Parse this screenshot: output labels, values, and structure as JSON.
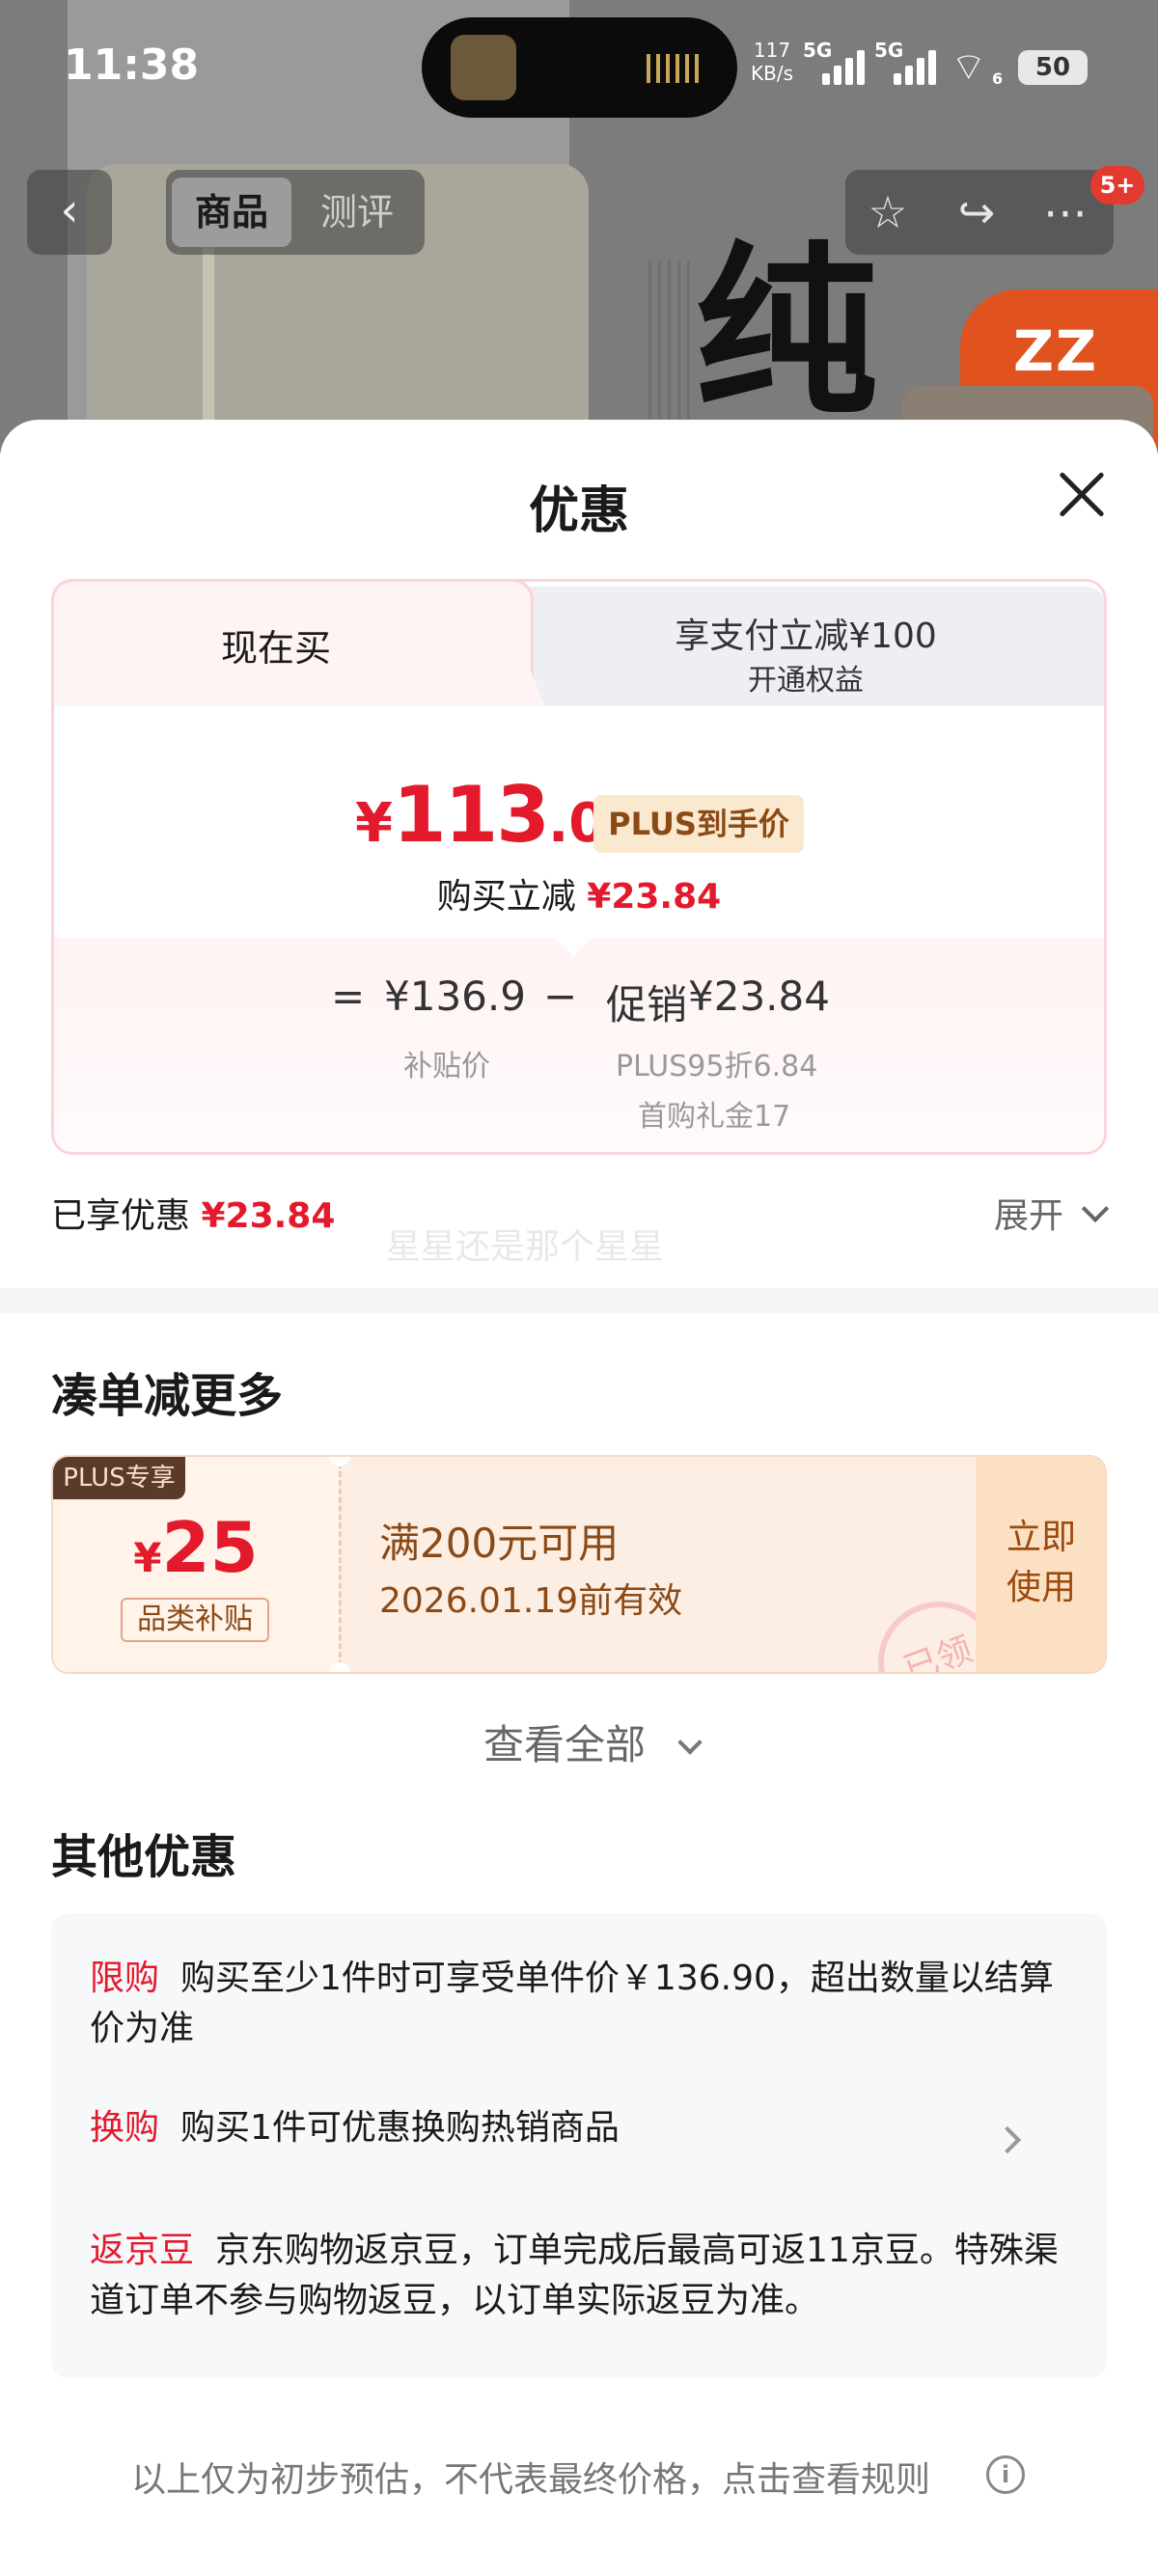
{
  "status_bar": {
    "time": "11:38",
    "net_speed_value": "117",
    "net_speed_unit": "KB/s",
    "sim1_label": "5G",
    "sim2_label": "5G",
    "wifi_sub": "6",
    "battery": "50"
  },
  "product_nav": {
    "back_glyph": "‹",
    "tabs": [
      {
        "label": "商品",
        "active": true
      },
      {
        "label": "测评",
        "active": false
      }
    ],
    "cart_badge": "5+"
  },
  "backdrop": {
    "big_char": "纯",
    "brand_text": "ZZ"
  },
  "sheet": {
    "title": "优惠",
    "price_card": {
      "tab_now": "现在买",
      "tab_pay_line1": "享支付立减¥100",
      "tab_pay_line2": "开通权益",
      "currency": "¥",
      "price_int": "113",
      "price_dec": ".06",
      "plus_tag": "PLUS到手价",
      "reduce_label": "购买立减",
      "reduce_amount": "¥23.84",
      "eq_sign": "=",
      "subsidy_price": "¥136.9",
      "minus_sign": "−",
      "promo_label": "促销",
      "promo_amount": "¥23.84",
      "subsidy_label": "补贴价",
      "promo_detail_1": "PLUS95折6.84",
      "promo_detail_2": "首购礼金17"
    },
    "saved": {
      "label": "已享优惠",
      "amount": "¥23.84",
      "expand": "展开"
    },
    "watermark": "星星还是那个星星",
    "more_section": {
      "title": "凑单减更多",
      "coupon": {
        "plus_badge": "PLUS专享",
        "currency": "¥",
        "amount": "25",
        "type": "品类补贴",
        "condition": "满200元可用",
        "expiry": "2026.01.19前有效",
        "use_line1": "立即",
        "use_line2": "使用",
        "stamp": "已领"
      },
      "view_all": "查看全部"
    },
    "other_section": {
      "title": "其他优惠",
      "offers": [
        {
          "tag": "限购",
          "text": "购买至少1件时可享受单件价￥136.90，超出数量以结算价为准"
        },
        {
          "tag": "换购",
          "text": "购买1件可优惠换购热销商品"
        },
        {
          "tag": "返京豆",
          "text": "京东购物返京豆，订单完成后最高可返11京豆。特殊渠道订单不参与购物返豆，以订单实际返豆为准。"
        }
      ]
    },
    "footnote": "以上仅为初步预估，不代表最终价格，点击查看规则",
    "info_glyph": "i"
  },
  "colors": {
    "accent_red": "#e3192c",
    "plus_gold_bg": "#fbe9cf",
    "coupon_bg": "#fdeee4"
  }
}
